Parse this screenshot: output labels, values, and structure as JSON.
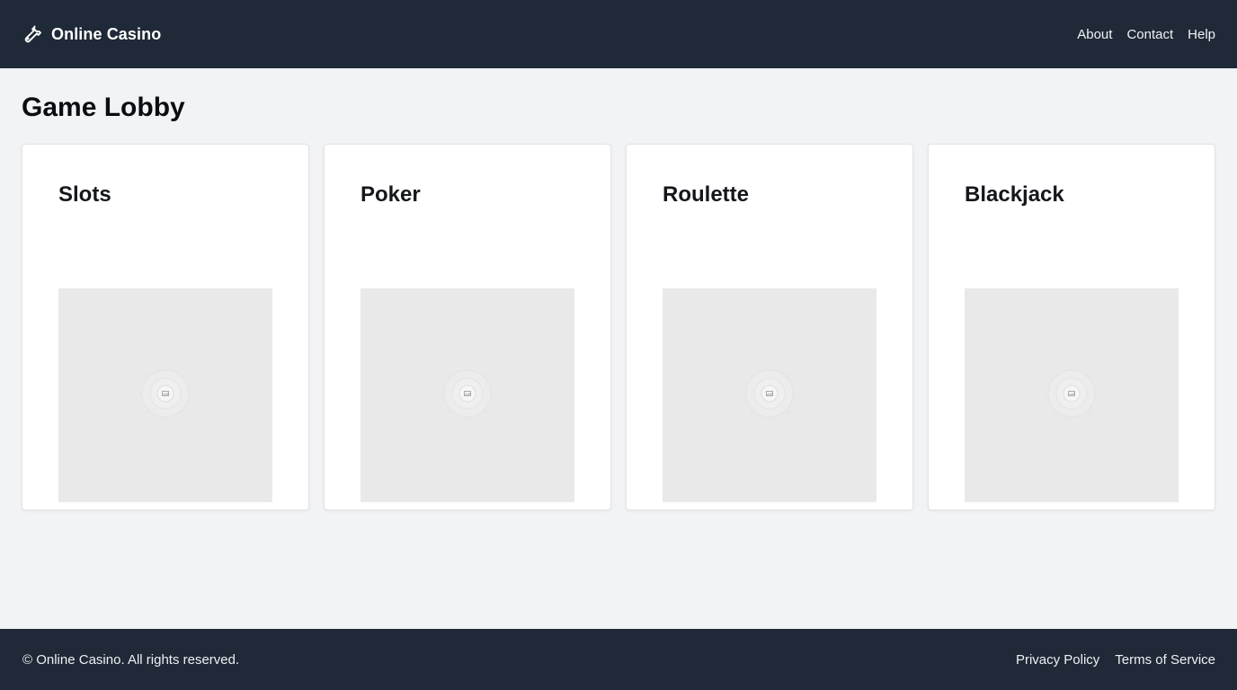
{
  "header": {
    "brand_name": "Online Casino",
    "brand_icon": "wrench-icon",
    "nav": [
      {
        "label": "About"
      },
      {
        "label": "Contact"
      },
      {
        "label": "Help"
      }
    ]
  },
  "main": {
    "page_title": "Game Lobby",
    "games": [
      {
        "title": "Slots",
        "image_icon": "image-placeholder-icon"
      },
      {
        "title": "Poker",
        "image_icon": "image-placeholder-icon"
      },
      {
        "title": "Roulette",
        "image_icon": "image-placeholder-icon"
      },
      {
        "title": "Blackjack",
        "image_icon": "image-placeholder-icon"
      }
    ]
  },
  "footer": {
    "copyright": "© Online Casino. All rights reserved.",
    "links": [
      {
        "label": "Privacy Policy"
      },
      {
        "label": "Terms of Service"
      }
    ]
  },
  "colors": {
    "header_bg": "#1f2937",
    "page_bg": "#f2f3f5",
    "card_bg": "#ffffff",
    "image_placeholder_bg": "#e9e9e9"
  }
}
